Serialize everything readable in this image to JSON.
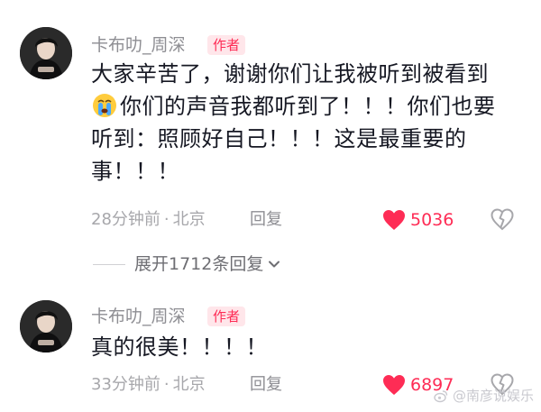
{
  "comments": [
    {
      "username": "卡布叻_周深",
      "badge": "作者",
      "lines": [
        "大家辛苦了，谢谢你们让我被听到被看到",
        "你们的声音我都听到了！！！你们也要",
        "听到：照顾好自己！！！这是最重要的",
        "事！！！"
      ],
      "emoji": "😭",
      "time": "28分钟前",
      "dot": "·",
      "location": "北京",
      "reply_label": "回复",
      "likes": "5036"
    },
    {
      "username": "卡布叻_周深",
      "badge": "作者",
      "lines": [
        "真的很美！！！！"
      ],
      "time": "33分钟前",
      "dot": "·",
      "location": "北京",
      "reply_label": "回复",
      "likes": "6897"
    }
  ],
  "expand_replies": {
    "label": "展开1712条回复"
  },
  "watermark": {
    "text": "@南彦说娱乐"
  },
  "colors": {
    "accent": "#fe2c55",
    "text": "#161823",
    "muted": "#a7a7ab"
  }
}
